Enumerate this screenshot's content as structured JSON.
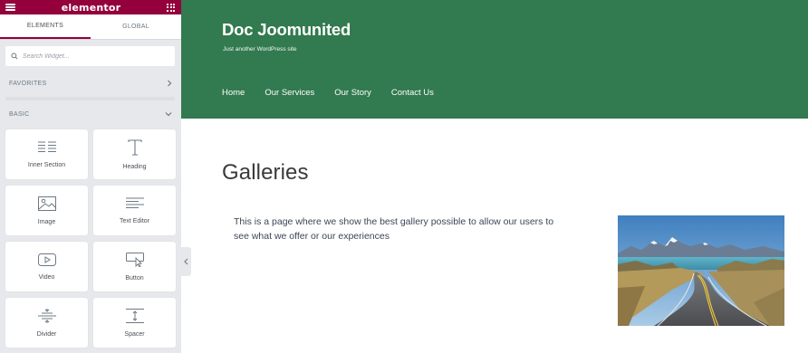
{
  "panel": {
    "brand": "elementor",
    "tabs": [
      {
        "label": "ELEMENTS",
        "active": true
      },
      {
        "label": "GLOBAL",
        "active": false
      }
    ],
    "search": {
      "placeholder": "Search Widget..."
    },
    "categories": {
      "favorites": "FAVORITES",
      "basic": "BASIC"
    },
    "widgets": [
      {
        "label": "Inner Section",
        "icon": "inner-section-icon"
      },
      {
        "label": "Heading",
        "icon": "heading-icon"
      },
      {
        "label": "Image",
        "icon": "image-icon"
      },
      {
        "label": "Text Editor",
        "icon": "text-editor-icon"
      },
      {
        "label": "Video",
        "icon": "video-icon"
      },
      {
        "label": "Button",
        "icon": "button-icon"
      },
      {
        "label": "Divider",
        "icon": "divider-icon"
      },
      {
        "label": "Spacer",
        "icon": "spacer-icon"
      }
    ],
    "colors": {
      "accent": "#93003c",
      "background": "#e6e8ec"
    }
  },
  "site": {
    "title": "Doc Joomunited",
    "tagline": "Just another WordPress site",
    "nav": [
      "Home",
      "Our Services",
      "Our Story",
      "Contact Us"
    ],
    "header_color": "#327a4f",
    "page_title": "Galleries",
    "intro_text": "This is a page where we show the best gallery possible to allow our users to see what we offer or our experiences",
    "image": {
      "subject": "mountain-road-landscape"
    }
  }
}
